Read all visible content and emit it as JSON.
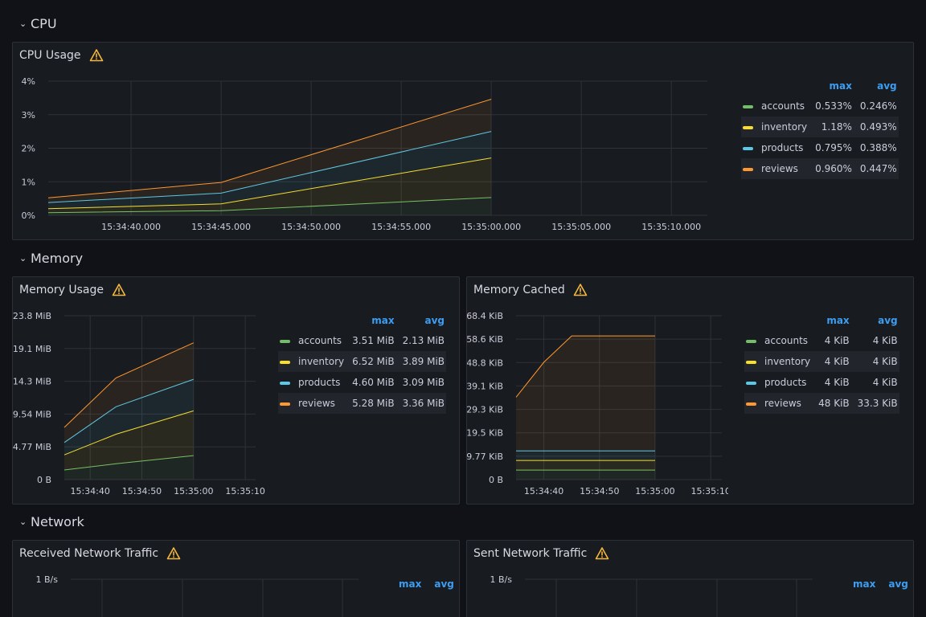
{
  "rows": {
    "cpu": "CPU",
    "memory": "Memory",
    "network": "Network"
  },
  "colors": {
    "accounts": "#73bf69",
    "inventory": "#fade2a",
    "products": "#5ac8e6",
    "reviews": "#ff9830",
    "accent": "#3d9df2",
    "warning": "#f5b73d"
  },
  "icons": {
    "row": "chevron-down-icon",
    "warning": "warning-icon"
  },
  "panels": {
    "cpu_usage": {
      "title": "CPU Usage",
      "legend": {
        "headers": [
          "max",
          "avg"
        ],
        "rows": [
          {
            "name": "accounts",
            "max": "0.533%",
            "avg": "0.246%"
          },
          {
            "name": "inventory",
            "max": "1.18%",
            "avg": "0.493%"
          },
          {
            "name": "products",
            "max": "0.795%",
            "avg": "0.388%"
          },
          {
            "name": "reviews",
            "max": "0.960%",
            "avg": "0.447%"
          }
        ]
      }
    },
    "memory_usage": {
      "title": "Memory Usage",
      "legend": {
        "headers": [
          "max",
          "avg"
        ],
        "rows": [
          {
            "name": "accounts",
            "max": "3.51 MiB",
            "avg": "2.13 MiB"
          },
          {
            "name": "inventory",
            "max": "6.52 MiB",
            "avg": "3.89 MiB"
          },
          {
            "name": "products",
            "max": "4.60 MiB",
            "avg": "3.09 MiB"
          },
          {
            "name": "reviews",
            "max": "5.28 MiB",
            "avg": "3.36 MiB"
          }
        ]
      }
    },
    "memory_cached": {
      "title": "Memory Cached",
      "legend": {
        "headers": [
          "max",
          "avg"
        ],
        "rows": [
          {
            "name": "accounts",
            "max": "4 KiB",
            "avg": "4 KiB"
          },
          {
            "name": "inventory",
            "max": "4 KiB",
            "avg": "4 KiB"
          },
          {
            "name": "products",
            "max": "4 KiB",
            "avg": "4 KiB"
          },
          {
            "name": "reviews",
            "max": "48 KiB",
            "avg": "33.3 KiB"
          }
        ]
      }
    },
    "received_network": {
      "title": "Received Network Traffic",
      "legend": {
        "headers": [
          "max",
          "avg"
        ],
        "rows": []
      }
    },
    "sent_network": {
      "title": "Sent Network Traffic",
      "legend": {
        "headers": [
          "max",
          "avg"
        ],
        "rows": []
      }
    }
  },
  "chart_data": [
    {
      "id": "cpu",
      "type": "area",
      "stacked": true,
      "y_ticks": [
        "0%",
        "1%",
        "2%",
        "3%",
        "4%"
      ],
      "ylim": [
        0,
        4
      ],
      "x_ticks": [
        "15:34:40.000",
        "15:34:45.000",
        "15:34:50.000",
        "15:34:55.000",
        "15:35:00.000",
        "15:35:05.000",
        "15:35:10.000"
      ],
      "x_tick_values": [
        40,
        45,
        50,
        55,
        60,
        65,
        70
      ],
      "xlim": [
        35.4,
        72
      ],
      "x": [
        35.4,
        45,
        60
      ],
      "series": [
        {
          "name": "accounts",
          "values": [
            0.08,
            0.14,
            0.53
          ]
        },
        {
          "name": "inventory",
          "values": [
            0.12,
            0.2,
            1.18
          ]
        },
        {
          "name": "products",
          "values": [
            0.18,
            0.32,
            0.79
          ]
        },
        {
          "name": "reviews",
          "values": [
            0.14,
            0.32,
            0.96
          ]
        }
      ],
      "grid": true
    },
    {
      "id": "mem",
      "type": "area",
      "stacked": true,
      "y_ticks": [
        "0 B",
        "4.77 MiB",
        "9.54 MiB",
        "14.3 MiB",
        "19.1 MiB",
        "23.8 MiB"
      ],
      "ylim": [
        0,
        23.84
      ],
      "x_ticks": [
        "15:34:40",
        "15:34:50",
        "15:35:00",
        "15:35:10"
      ],
      "x_tick_values": [
        40,
        50,
        60,
        70
      ],
      "xlim": [
        35,
        72
      ],
      "x": [
        35,
        45,
        60
      ],
      "series": [
        {
          "name": "accounts",
          "values": [
            1.4,
            2.3,
            3.5
          ]
        },
        {
          "name": "inventory",
          "values": [
            2.2,
            4.3,
            6.5
          ]
        },
        {
          "name": "products",
          "values": [
            1.8,
            4.0,
            4.6
          ]
        },
        {
          "name": "reviews",
          "values": [
            2.2,
            4.2,
            5.3
          ]
        }
      ],
      "grid": true
    },
    {
      "id": "cached",
      "type": "area",
      "stacked": true,
      "y_ticks": [
        "0 B",
        "9.77 KiB",
        "19.5 KiB",
        "29.3 KiB",
        "39.1 KiB",
        "48.8 KiB",
        "58.6 KiB",
        "68.4 KiB"
      ],
      "ylim": [
        0,
        68.4
      ],
      "x_ticks": [
        "15:34:40",
        "15:34:50",
        "15:35:00",
        "15:35:10"
      ],
      "x_tick_values": [
        40,
        50,
        60,
        70
      ],
      "xlim": [
        35,
        72
      ],
      "x": [
        35,
        40,
        45,
        60
      ],
      "series": [
        {
          "name": "accounts",
          "values": [
            4,
            4,
            4,
            4
          ]
        },
        {
          "name": "inventory",
          "values": [
            4,
            4,
            4,
            4
          ]
        },
        {
          "name": "products",
          "values": [
            4,
            4,
            4,
            4
          ]
        },
        {
          "name": "reviews",
          "values": [
            22.4,
            37,
            48,
            48
          ]
        }
      ],
      "grid": true
    },
    {
      "id": "recv",
      "type": "line",
      "y_ticks": [
        "1 B/s"
      ],
      "ylim": [
        0,
        1
      ],
      "x_ticks": [],
      "grid": true,
      "series": []
    },
    {
      "id": "sent",
      "type": "line",
      "y_ticks": [
        "1 B/s"
      ],
      "ylim": [
        0,
        1
      ],
      "x_ticks": [],
      "grid": true,
      "series": []
    }
  ]
}
